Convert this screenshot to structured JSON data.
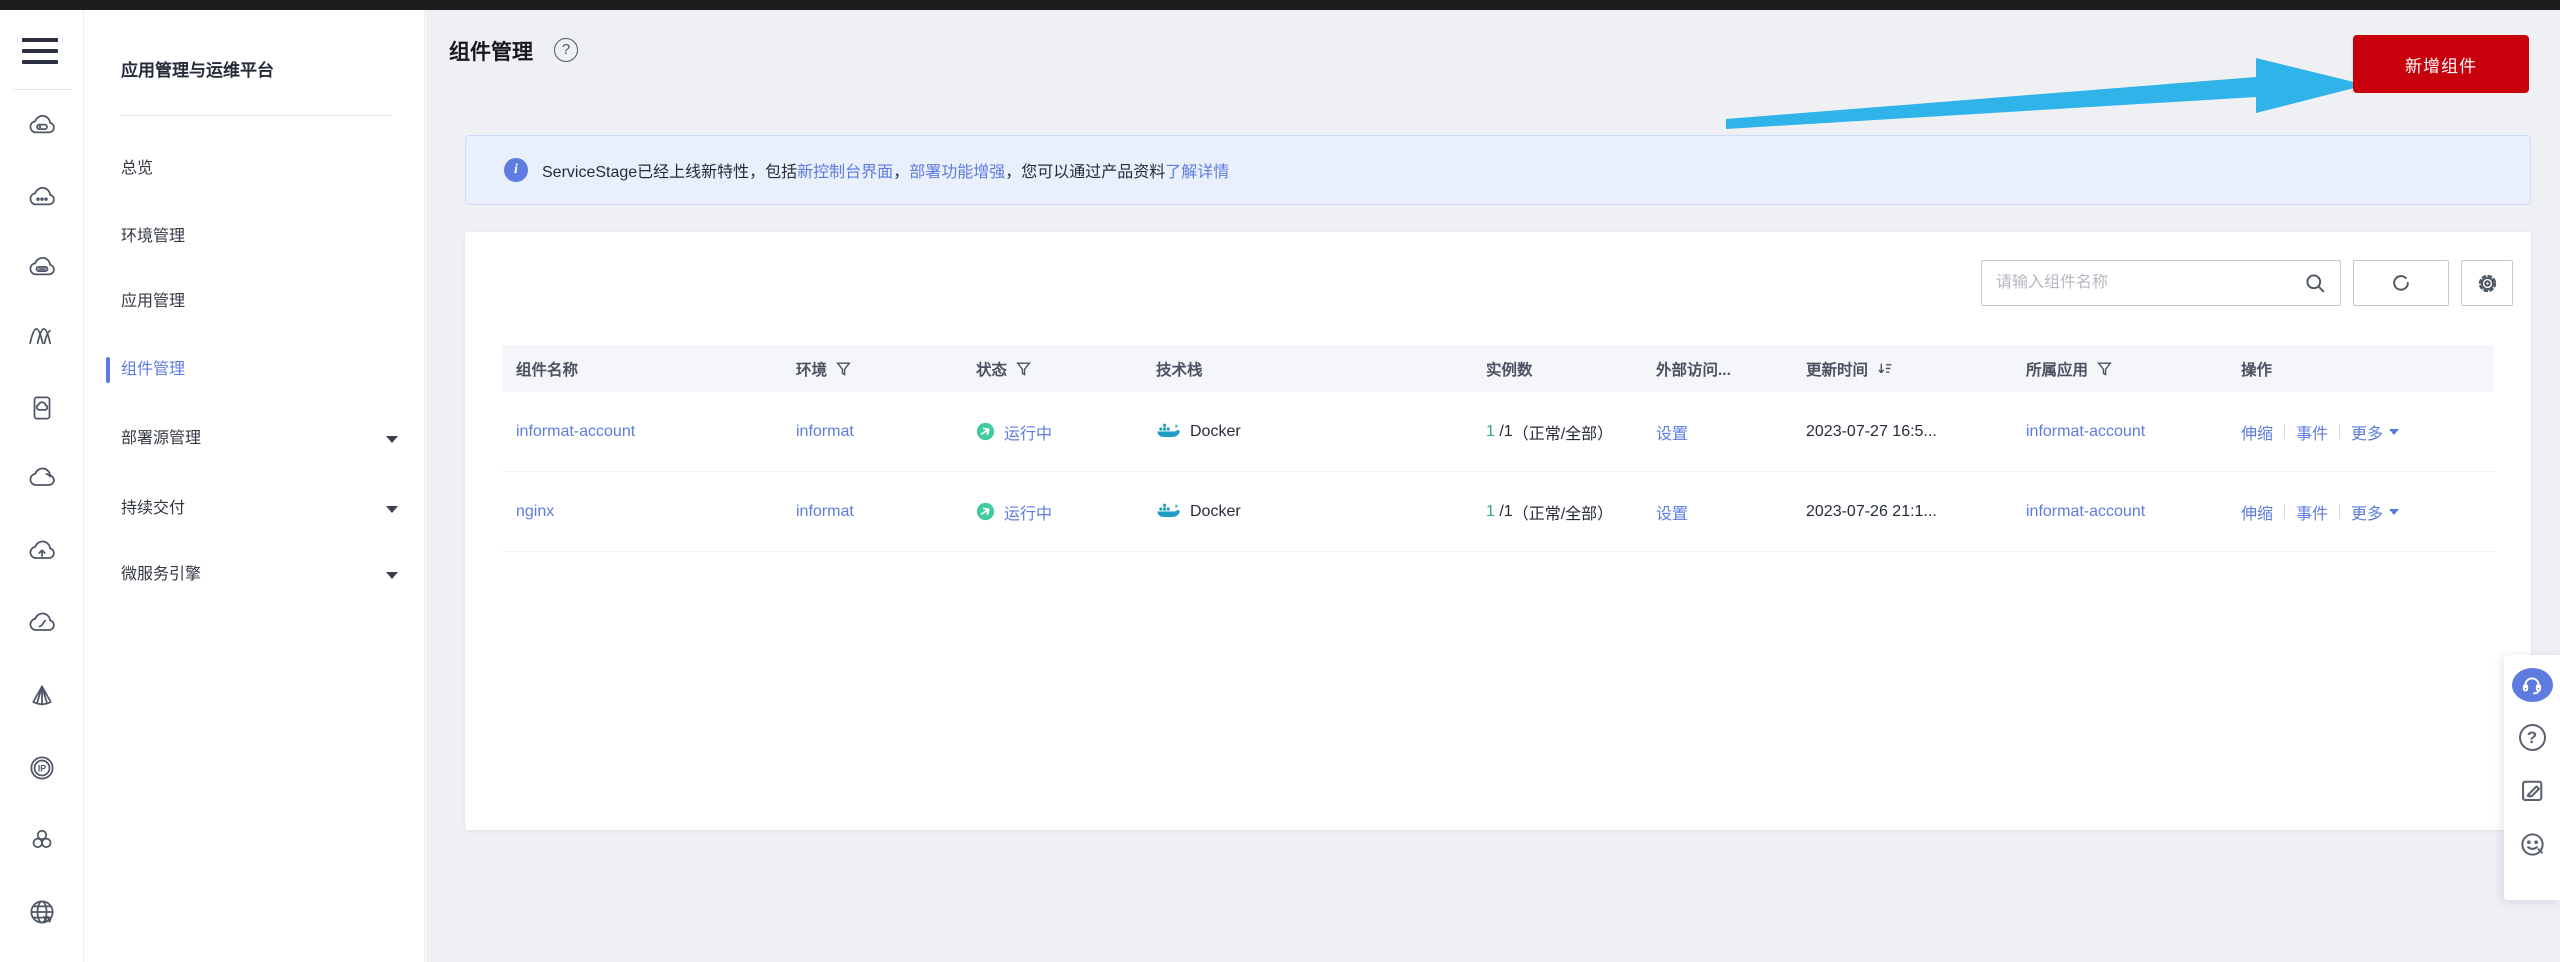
{
  "colors": {
    "accent_red": "#c7000b",
    "link_blue": "#5e7ce0",
    "success_green": "#3fcc9d",
    "arrow_annotation_blue": "#2fb3e8",
    "banner_bg": "#e9f0fc",
    "topbar": "#1d1d20",
    "docker_teal": "#1e9ec4"
  },
  "sidebar": {
    "title": "应用管理与运维平台",
    "items": [
      {
        "label": "总览",
        "selected": false,
        "expandable": false
      },
      {
        "label": "环境管理",
        "selected": false,
        "expandable": false
      },
      {
        "label": "应用管理",
        "selected": false,
        "expandable": false
      },
      {
        "label": "组件管理",
        "selected": true,
        "expandable": false
      },
      {
        "label": "部署源管理",
        "selected": false,
        "expandable": true
      },
      {
        "label": "持续交付",
        "selected": false,
        "expandable": true
      },
      {
        "label": "微服务引擎",
        "selected": false,
        "expandable": true
      }
    ]
  },
  "icon_rail": {
    "icons": [
      "cloud-server",
      "cloud-more",
      "cloud-db",
      "waves",
      "tablet-cloud",
      "cloud",
      "cloud-upload",
      "cloud-meter",
      "pyramid",
      "ip",
      "cluster",
      "globe"
    ]
  },
  "page": {
    "title": "组件管理",
    "add_button_label": "新增组件"
  },
  "banner": {
    "segments": [
      "ServiceStage已经上线新特性，包括",
      "新控制台界面",
      "，",
      "部署功能增强",
      "，您可以通过产品资料",
      "了解详情"
    ]
  },
  "toolbar": {
    "search_placeholder": "请输入组件名称"
  },
  "glyphs": {
    "help": "?",
    "info": "i",
    "refresh": "C",
    "ip": "IP",
    "globe_w": "W"
  },
  "table": {
    "columns": [
      {
        "label": "组件名称"
      },
      {
        "label": "环境",
        "filter": true
      },
      {
        "label": "状态",
        "filter": true
      },
      {
        "label": "技术栈"
      },
      {
        "label": "实例数"
      },
      {
        "label": "外部访问..."
      },
      {
        "label": "更新时间",
        "sort": true
      },
      {
        "label": "所属应用",
        "filter": true
      },
      {
        "label": "操作"
      }
    ],
    "rows": [
      {
        "name": "informat-account",
        "env": "informat",
        "status": "运行中",
        "stack": "Docker",
        "instances_ok": "1",
        "instances_total": "/1",
        "instances_note": "（正常/全部）",
        "external_action": "设置",
        "updated": "2023-07-27 16:5...",
        "app": "informat-account",
        "actions": [
          "伸缩",
          "事件",
          "更多"
        ]
      },
      {
        "name": "nginx",
        "env": "informat",
        "status": "运行中",
        "stack": "Docker",
        "instances_ok": "1",
        "instances_total": "/1",
        "instances_note": "（正常/全部）",
        "external_action": "设置",
        "updated": "2023-07-26 21:1...",
        "app": "informat-account",
        "actions": [
          "伸缩",
          "事件",
          "更多"
        ]
      }
    ]
  }
}
